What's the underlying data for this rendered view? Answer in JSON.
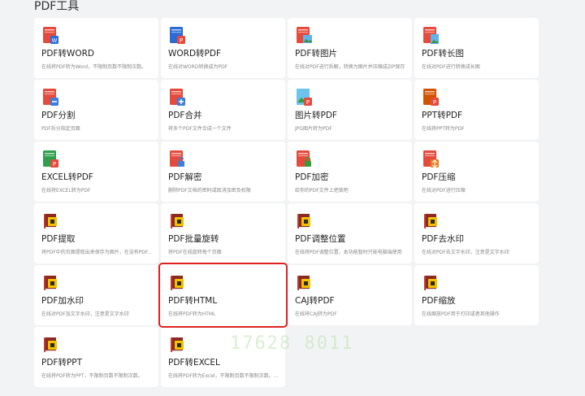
{
  "section_title": "PDF工具",
  "watermark": "17628 8011",
  "cards": [
    {
      "title": "PDF转WORD",
      "desc": "在线将PDF转为Word，不限制页数不限制次数。",
      "icon": "pdf-to-word-icon"
    },
    {
      "title": "WORD转PDF",
      "desc": "在线对WORD转换成为PDF",
      "icon": "word-to-pdf-icon"
    },
    {
      "title": "PDF转图片",
      "desc": "在线对PDF进行拆解，转换为图片并压缩成ZIP保存",
      "icon": "pdf-to-image-icon"
    },
    {
      "title": "PDF转长图",
      "desc": "在线对PDF进行转换成长图",
      "icon": "pdf-to-long-image-icon"
    },
    {
      "title": "PDF分割",
      "desc": "PDF拆分指定页面",
      "icon": "pdf-split-icon"
    },
    {
      "title": "PDF合并",
      "desc": "将多个PDF文件合成一个文件",
      "icon": "pdf-merge-icon"
    },
    {
      "title": "图片转PDF",
      "desc": "JPG图片转为PDF",
      "icon": "image-to-pdf-icon"
    },
    {
      "title": "PPT转PDF",
      "desc": "在线将PPT转为PDF",
      "icon": "ppt-to-pdf-icon"
    },
    {
      "title": "EXCEL转PDF",
      "desc": "在线将EXCEL转为PDF",
      "icon": "excel-to-pdf-icon"
    },
    {
      "title": "PDF解密",
      "desc": "删除PDF文档的密码或取消加密及权限",
      "icon": "pdf-decrypt-icon"
    },
    {
      "title": "PDF加密",
      "desc": "给你的PDF文件上把锁吧",
      "icon": "pdf-encrypt-icon"
    },
    {
      "title": "PDF压缩",
      "desc": "在线对PDF进行压缩",
      "icon": "pdf-compress-icon"
    },
    {
      "title": "PDF提取",
      "desc": "将PDF中的页面提取出来保存为图片，在没有PDF...",
      "icon": "pdf-extract-icon"
    },
    {
      "title": "PDF批量旋转",
      "desc": "将PDF在线旋转每个页面",
      "icon": "pdf-rotate-icon"
    },
    {
      "title": "PDF调整位置",
      "desc": "在线将PDF调整位置，本功能暂时只能电脑端使用",
      "icon": "pdf-reorder-icon"
    },
    {
      "title": "PDF去水印",
      "desc": "在线对PDF去文字水印，注意是文字水印",
      "icon": "pdf-remove-watermark-icon"
    },
    {
      "title": "PDF加水印",
      "desc": "在线对PDF加文字水印，注意是文字水印",
      "icon": "pdf-add-watermark-icon"
    },
    {
      "title": "PDF转HTML",
      "desc": "在线将PDF转为HTML",
      "icon": "pdf-to-html-icon",
      "selected": true
    },
    {
      "title": "CAJ转PDF",
      "desc": "在线将CAJ转为PDF",
      "icon": "caj-to-pdf-icon"
    },
    {
      "title": "PDF缩放",
      "desc": "在线缩放PDF用于打印或者其他操作",
      "icon": "pdf-scale-icon"
    },
    {
      "title": "PDF转PPT",
      "desc": "在线将PDF转为PPT，不限制页数不限制次数。",
      "icon": "pdf-to-ppt-icon"
    },
    {
      "title": "PDF转EXCEL",
      "desc": "在线将PDF转为Excel，不限制页数不限制次数。...",
      "icon": "pdf-to-excel-icon"
    }
  ],
  "colors": {
    "pdf_red": "#e64a3c",
    "word_blue": "#2b6cd4",
    "excel_green": "#2e9e4f",
    "book_red": "#c0392b",
    "book_yellow": "#f2c200",
    "selected_border": "#e02020"
  }
}
